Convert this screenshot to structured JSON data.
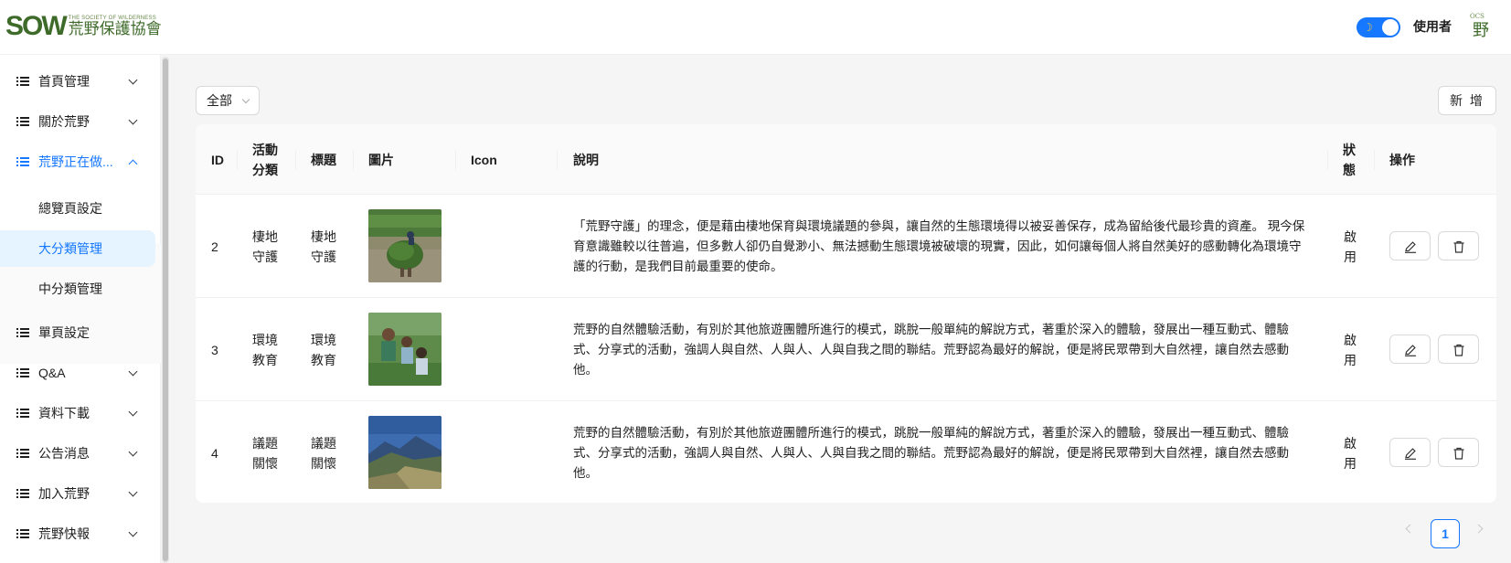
{
  "header": {
    "logo_mark": "SOW",
    "logo_en": "THE SOCIETY OF WILDERNESS",
    "logo_zh": "荒野保護協會",
    "theme_toggle": "on",
    "user_name": "使用者",
    "avatar_text": "野"
  },
  "sidebar": {
    "items": [
      {
        "label": "首頁管理",
        "icon": "list-icon",
        "expandable": true
      },
      {
        "label": "關於荒野",
        "icon": "list-icon",
        "expandable": true
      },
      {
        "label": "荒野正在做...",
        "icon": "list-icon",
        "expandable": true,
        "open": true
      },
      {
        "label": "單頁設定",
        "icon": "list-icon",
        "expandable": false
      },
      {
        "label": "Q&A",
        "icon": "list-icon",
        "expandable": true
      },
      {
        "label": "資料下載",
        "icon": "list-icon",
        "expandable": true
      },
      {
        "label": "公告消息",
        "icon": "list-icon",
        "expandable": true
      },
      {
        "label": "加入荒野",
        "icon": "list-icon",
        "expandable": true
      },
      {
        "label": "荒野快報",
        "icon": "list-icon",
        "expandable": true
      }
    ],
    "submenu": [
      {
        "label": "總覽頁設定"
      },
      {
        "label": "大分類管理",
        "active": true
      },
      {
        "label": "中分類管理"
      }
    ]
  },
  "toolbar": {
    "filter_value": "全部",
    "add_label": "新 增"
  },
  "table": {
    "columns": [
      "ID",
      "活動\n分類",
      "標題",
      "圖片",
      "Icon",
      "說明",
      "狀\n態",
      "操作"
    ],
    "rows": [
      {
        "id": "2",
        "category": "棲地\n守護",
        "title": "棲地\n守護",
        "image": "person-carrying-plants-photo",
        "icon": "",
        "description": "「荒野守護」的理念，便是藉由棲地保育與環境議題的參與，讓自然的生態環境得以被妥善保存，成為留給後代最珍貴的資產。 現今保育意識雖較以往普遍，但多數人卻仍自覺渺小、無法撼動生態環境被破壞的現實，因此，如何讓每個人將自然美好的感動轉化為環境守護的行動，是我們目前最重要的使命。",
        "status": "啟\n用"
      },
      {
        "id": "3",
        "category": "環境\n教育",
        "title": "環境\n教育",
        "image": "children-in-nature-photo",
        "icon": "",
        "description": "荒野的自然體驗活動，有別於其他旅遊團體所進行的模式，跳脫一般單純的解說方式，著重於深入的體驗，發展出一種互動式、體驗式、分享式的活動，強調人與自然、人與人、人與自我之間的聯結。荒野認為最好的解說，便是將民眾帶到大自然裡，讓自然去感動他。",
        "status": "啟\n用"
      },
      {
        "id": "4",
        "category": "議題\n關懷",
        "title": "議題\n關懷",
        "image": "mountain-landscape-photo",
        "icon": "",
        "description": "荒野的自然體驗活動，有別於其他旅遊團體所進行的模式，跳脫一般單純的解說方式，著重於深入的體驗，發展出一種互動式、體驗式、分享式的活動，強調人與自然、人與人、人與自我之間的聯結。荒野認為最好的解說，便是將民眾帶到大自然裡，讓自然去感動他。",
        "status": "啟\n用"
      }
    ]
  },
  "pagination": {
    "current": "1"
  },
  "colors": {
    "accent": "#1677ff",
    "brand_green": "#3e6b2a"
  }
}
